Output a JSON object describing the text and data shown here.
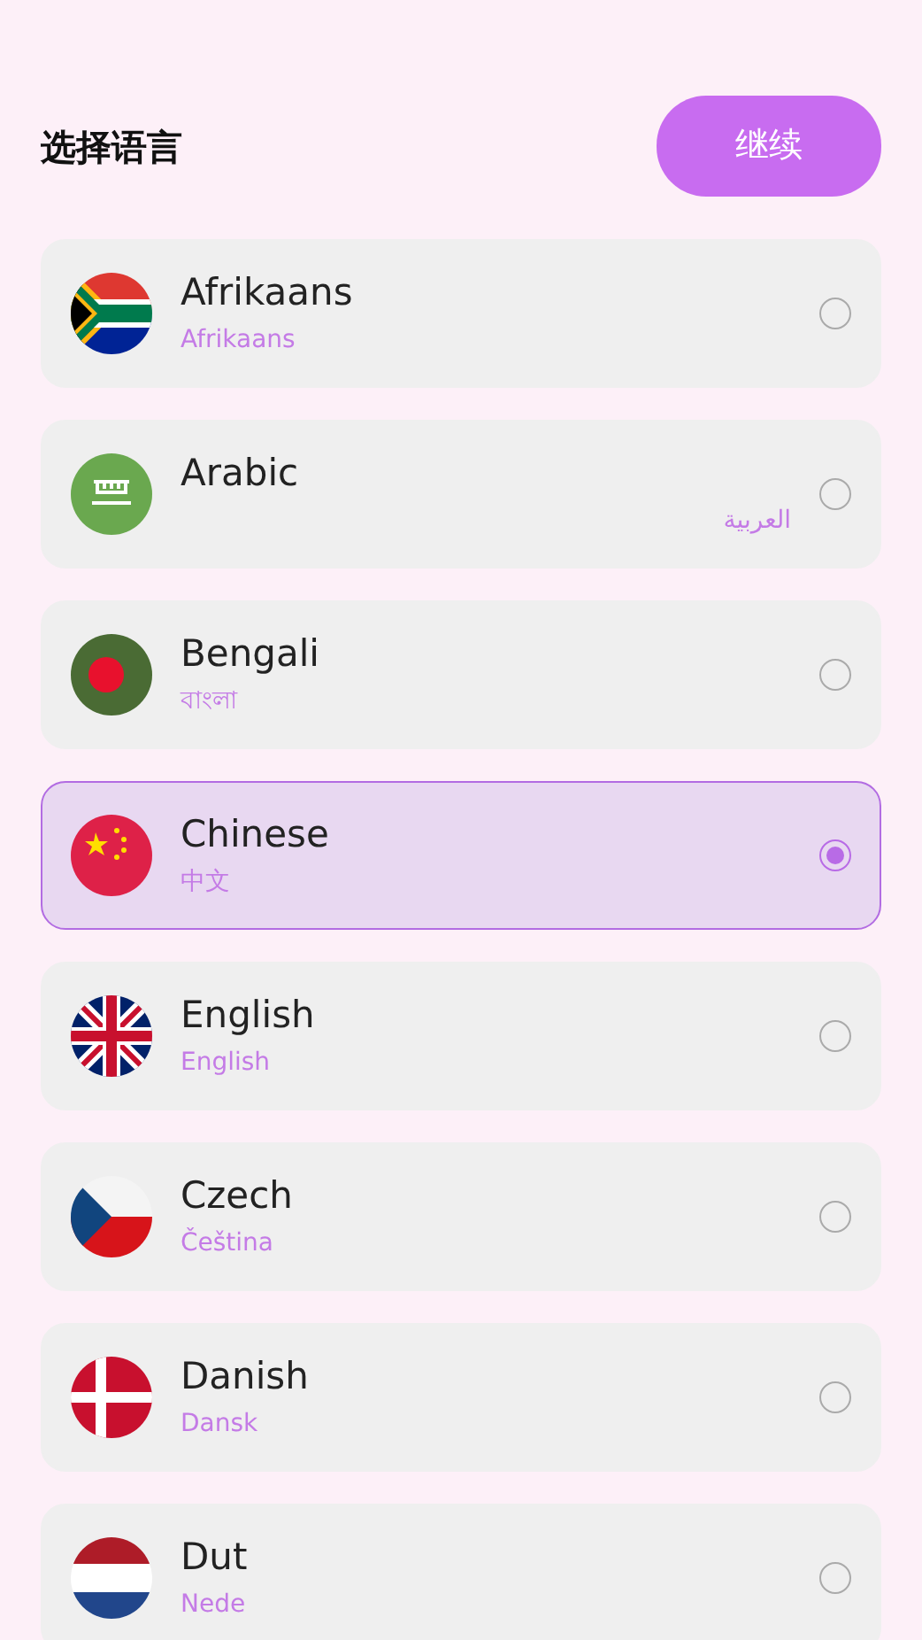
{
  "header": {
    "title": "选择语言",
    "continue_button": "继续"
  },
  "languages": [
    {
      "name": "Afrikaans",
      "native": "Afrikaans",
      "selected": false
    },
    {
      "name": "Arabic",
      "native": "العربية",
      "selected": false
    },
    {
      "name": "Bengali",
      "native": "বাংলা",
      "selected": false
    },
    {
      "name": "Chinese",
      "native": "中文",
      "selected": true
    },
    {
      "name": "English",
      "native": "English",
      "selected": false
    },
    {
      "name": "Czech",
      "native": "Čeština",
      "selected": false
    },
    {
      "name": "Danish",
      "native": "Dansk",
      "selected": false
    },
    {
      "name": "Dut",
      "native": "Nede",
      "selected": false
    }
  ]
}
